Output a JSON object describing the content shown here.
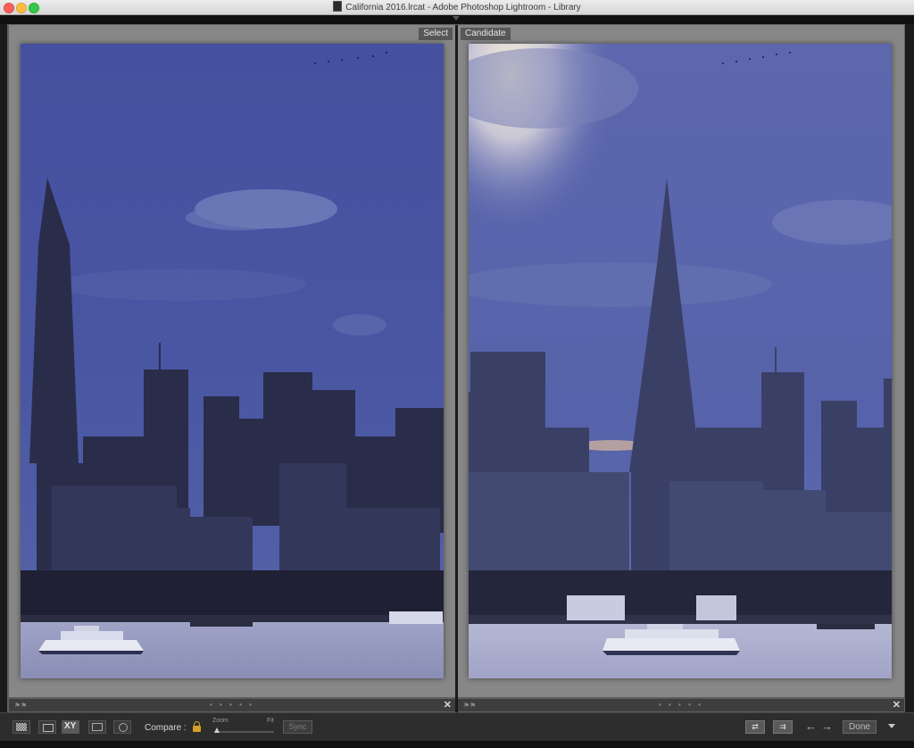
{
  "window": {
    "title": "California 2016.lrcat - Adobe Photoshop Lightroom - Library"
  },
  "compare_view": {
    "select_label": "Select",
    "candidate_label": "Candidate"
  },
  "toolbar": {
    "compare_label": "Compare :",
    "zoom_label": "Zoom",
    "zoom_preset": "Fit",
    "sync_label": "Sync",
    "xy_label": "XY",
    "done_label": "Done",
    "prev_arrow": "←",
    "next_arrow": "→",
    "close_glyph": "✕",
    "flag_glyph": "⚑⚑",
    "dots": "• • • • •"
  },
  "icons": {
    "grid_view": "grid-icon",
    "loupe_view": "loupe-icon",
    "compare_view": "compare-icon",
    "survey_view": "survey-icon",
    "people_view": "people-icon",
    "lock": "lock-icon",
    "swap": "swap-icon",
    "make_select": "make-select-icon"
  },
  "colors": {
    "lock_accent": "#d3a12a",
    "sky_dusk": "#4f5aa0",
    "water": "#a6a8c8"
  }
}
